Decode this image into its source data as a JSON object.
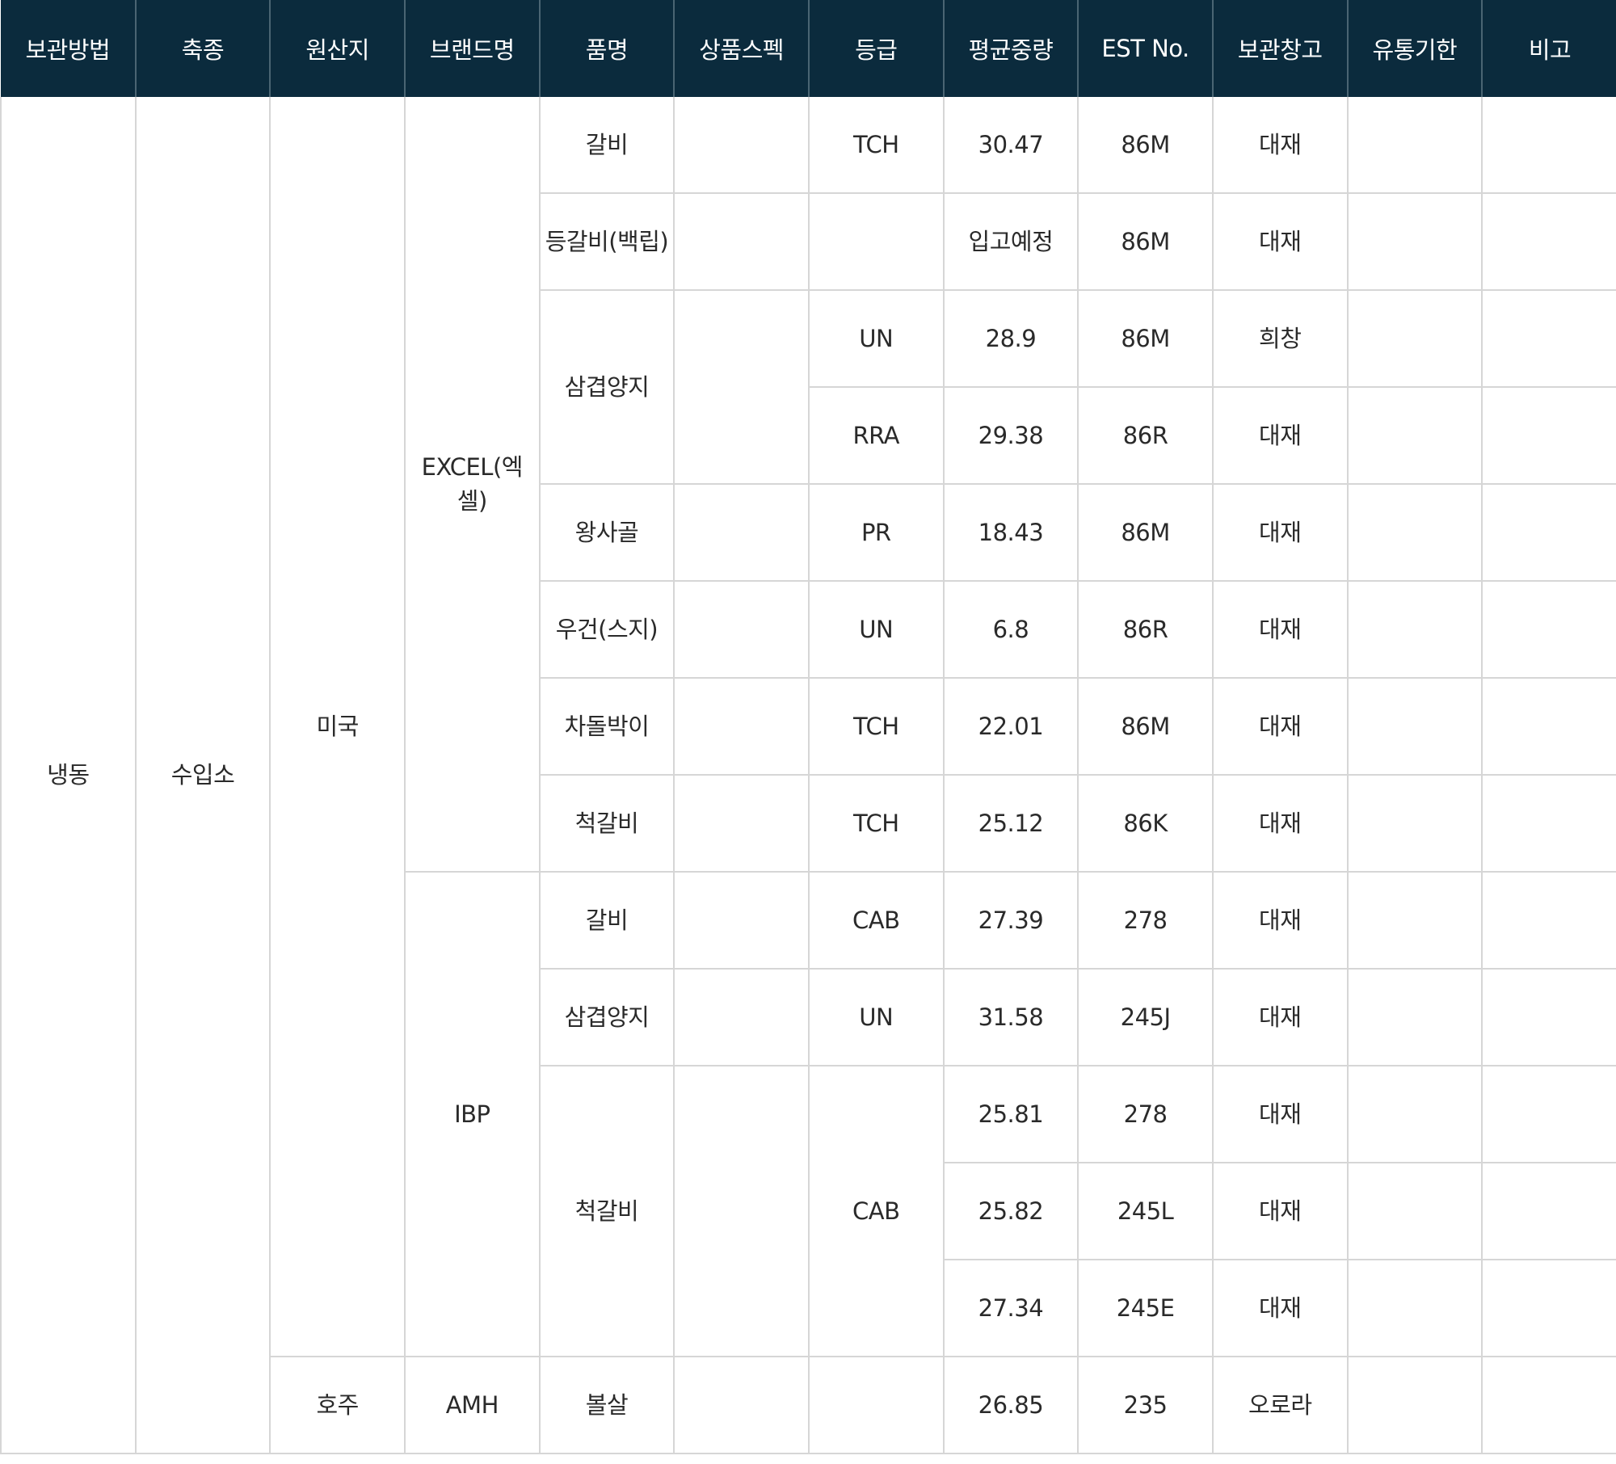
{
  "headers": [
    "보관방법",
    "축종",
    "원산지",
    "브랜드명",
    "품명",
    "상품스펙",
    "등급",
    "평균중량",
    "EST No.",
    "보관창고",
    "유통기한",
    "비고"
  ],
  "storage_method": "냉동",
  "species": "수입소",
  "origins": [
    {
      "name": "미국",
      "brands": [
        {
          "name": "EXCEL(엑셀)",
          "items": [
            {
              "name": "갈비",
              "spec": "",
              "grade": "TCH",
              "weight": "30.47",
              "est": "86M",
              "warehouse": "대재",
              "expiry": "",
              "note": ""
            },
            {
              "name": "등갈비(백립)",
              "spec": "",
              "grade": "",
              "weight": "입고예정",
              "est": "86M",
              "warehouse": "대재",
              "expiry": "",
              "note": ""
            },
            {
              "name": "삼겹양지",
              "spec": "",
              "grade": "UN",
              "weight": "28.9",
              "est": "86M",
              "warehouse": "희창",
              "expiry": "",
              "note": ""
            },
            {
              "name": "",
              "spec": "",
              "grade": "RRA",
              "weight": "29.38",
              "est": "86R",
              "warehouse": "대재",
              "expiry": "",
              "note": ""
            },
            {
              "name": "왕사골",
              "spec": "",
              "grade": "PR",
              "weight": "18.43",
              "est": "86M",
              "warehouse": "대재",
              "expiry": "",
              "note": ""
            },
            {
              "name": "우건(스지)",
              "spec": "",
              "grade": "UN",
              "weight": "6.8",
              "est": "86R",
              "warehouse": "대재",
              "expiry": "",
              "note": ""
            },
            {
              "name": "차돌박이",
              "spec": "",
              "grade": "TCH",
              "weight": "22.01",
              "est": "86M",
              "warehouse": "대재",
              "expiry": "",
              "note": ""
            },
            {
              "name": "척갈비",
              "spec": "",
              "grade": "TCH",
              "weight": "25.12",
              "est": "86K",
              "warehouse": "대재",
              "expiry": "",
              "note": ""
            }
          ]
        },
        {
          "name": "IBP",
          "items": [
            {
              "name": "갈비",
              "spec": "",
              "grade": "CAB",
              "weight": "27.39",
              "est": "278",
              "warehouse": "대재",
              "expiry": "",
              "note": ""
            },
            {
              "name": "삼겹양지",
              "spec": "",
              "grade": "UN",
              "weight": "31.58",
              "est": "245J",
              "warehouse": "대재",
              "expiry": "",
              "note": ""
            },
            {
              "name": "척갈비",
              "spec": "",
              "grade": "CAB",
              "weight": "25.81",
              "est": "278",
              "warehouse": "대재",
              "expiry": "",
              "note": ""
            },
            {
              "name": "",
              "spec": "",
              "grade": "",
              "weight": "25.82",
              "est": "245L",
              "warehouse": "대재",
              "expiry": "",
              "note": ""
            },
            {
              "name": "",
              "spec": "",
              "grade": "",
              "weight": "27.34",
              "est": "245E",
              "warehouse": "대재",
              "expiry": "",
              "note": ""
            }
          ]
        }
      ]
    },
    {
      "name": "호주",
      "brands": [
        {
          "name": "AMH",
          "items": [
            {
              "name": "볼살",
              "spec": "",
              "grade": "",
              "weight": "26.85",
              "est": "235",
              "warehouse": "오로라",
              "expiry": "",
              "note": ""
            }
          ]
        }
      ]
    }
  ]
}
